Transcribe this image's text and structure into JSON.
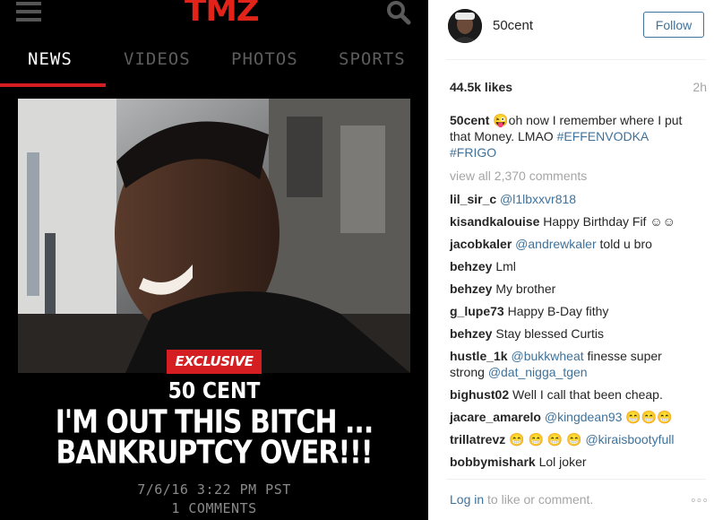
{
  "left": {
    "logo": "TMZ",
    "tabs": [
      {
        "label": "NEWS",
        "active": true
      },
      {
        "label": "VIDEOS",
        "active": false
      },
      {
        "label": "PHOTOS",
        "active": false
      },
      {
        "label": "SPORTS",
        "active": false
      }
    ],
    "badge": "EXCLUSIVE",
    "kicker": "50 CENT",
    "headline_line1": "I'M OUT THIS BITCH ...",
    "headline_line2": "BANKRUPTCY OVER!!!",
    "date": "7/6/16 3:22 PM PST",
    "comments": "1 COMMENTS",
    "colors": {
      "accent": "#d51e21",
      "background": "#000000"
    }
  },
  "right": {
    "username": "50cent",
    "follow_label": "Follow",
    "likes": "44.5k likes",
    "time": "2h",
    "caption": {
      "user": "50cent",
      "text": "😜oh now I remember where I put that Money. LMAO",
      "tag1": "#EFFENVODKA",
      "tag2": "#FRIGO"
    },
    "view_all": "view all 2,370 comments",
    "comments": [
      {
        "user": "lil_sir_c",
        "mention": "@l1lbxxvr818",
        "text": ""
      },
      {
        "user": "kisandkalouise",
        "text": "Happy Birthday Fif ☺☺"
      },
      {
        "user": "jacobkaler",
        "mention": "@andrewkaler",
        "text": "told u bro"
      },
      {
        "user": "behzey",
        "text": "Lml"
      },
      {
        "user": "behzey",
        "text": "My brother"
      },
      {
        "user": "g_lupe73",
        "text": "Happy B-Day fithy"
      },
      {
        "user": "behzey",
        "text": "Stay blessed Curtis"
      },
      {
        "user": "hustle_1k",
        "mention": "@bukkwheat",
        "text": "finesse super strong",
        "mention2": "@dat_nigga_tgen"
      },
      {
        "user": "bighust02",
        "text": "Well I call that been cheap."
      },
      {
        "user": "jacare_amarelo",
        "mention": "@kingdean93",
        "text": "😁😁😁"
      },
      {
        "user": "trillatrevz",
        "text": "😁 😁 😁 😁",
        "mention": "@kiraisbootyfull"
      },
      {
        "user": "bobbymishark",
        "text": "Lol joker"
      }
    ],
    "login_link": "Log in",
    "login_text": "to like or comment.",
    "more": "◦◦◦",
    "colors": {
      "link": "#3f729b",
      "muted": "#a5a5a5"
    }
  }
}
